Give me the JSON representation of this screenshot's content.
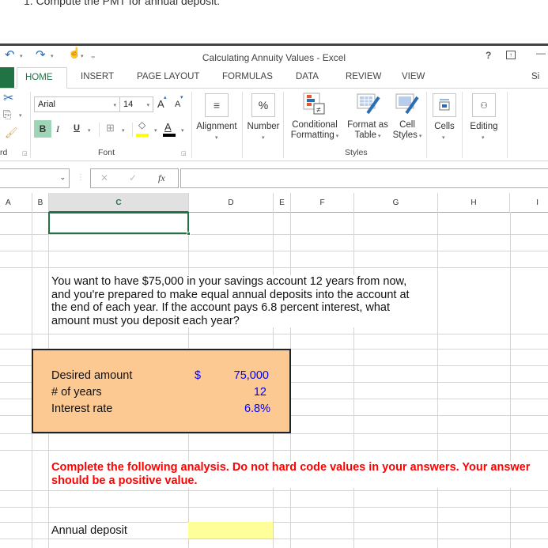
{
  "question": "1. Compute the PMT for annual deposit.",
  "window": {
    "title": "Calculating Annuity Values - Excel",
    "help": "?",
    "restore_icon": "ribbon-display-icon",
    "minimize": "—"
  },
  "quick_access": {
    "undo_icon": "undo-icon",
    "redo_icon": "redo-icon",
    "touch_icon": "touch-mode-icon",
    "customize_icon": "customize-qat-icon"
  },
  "tabs": [
    {
      "label": "HOME",
      "active": true
    },
    {
      "label": "INSERT"
    },
    {
      "label": "PAGE LAYOUT"
    },
    {
      "label": "FORMULAS"
    },
    {
      "label": "DATA"
    },
    {
      "label": "REVIEW"
    },
    {
      "label": "VIEW"
    }
  ],
  "sign_in": "Si",
  "ribbon": {
    "clipboard_label": "rd",
    "font": {
      "name": "Arial",
      "size": "14",
      "bold": "B",
      "italic": "I",
      "underline": "U",
      "grow": "A",
      "shrink": "A",
      "font_color_letter": "A",
      "label": "Font",
      "highlight_color": "#ffff00",
      "font_color": "#000000"
    },
    "alignment": "Alignment",
    "number": "Number",
    "number_symbol": "%",
    "conditional_formatting": [
      "Conditional",
      "Formatting"
    ],
    "format_as_table": [
      "Format as",
      "Table"
    ],
    "cell_styles": [
      "Cell",
      "Styles"
    ],
    "styles_label": "Styles",
    "cells": "Cells",
    "editing": "Editing"
  },
  "formula_bar": {
    "name_box": "",
    "cancel": "✕",
    "enter": "✓",
    "fx": "fx",
    "value": ""
  },
  "columns": [
    "A",
    "B",
    "C",
    "D",
    "E",
    "F",
    "G",
    "H",
    "I"
  ],
  "selected_column": "C",
  "sheet": {
    "problem_text": "You want to have $75,000 in your savings account 12 years from now, and you're prepared to make equal annual deposits into the account at the end of each year. If the account pays 6.8 percent interest, what amount must you deposit each year?",
    "inputs": [
      {
        "label": "Desired amount",
        "currency": "$",
        "value": "75,000"
      },
      {
        "label": "# of years",
        "currency": "",
        "value": "12"
      },
      {
        "label": "Interest rate",
        "currency": "",
        "value": "6.8%"
      }
    ],
    "input_box_color": "#fdc993",
    "input_value_color": "#0000ff",
    "instructions": "Complete the following analysis. Do not hard code values in your answers. Your answer should be a positive value.",
    "instructions_color": "#ff0000",
    "answer_label": "Annual deposit",
    "answer_value": "",
    "answer_cell_color": "#ffff99"
  },
  "accent_color": "#217346"
}
